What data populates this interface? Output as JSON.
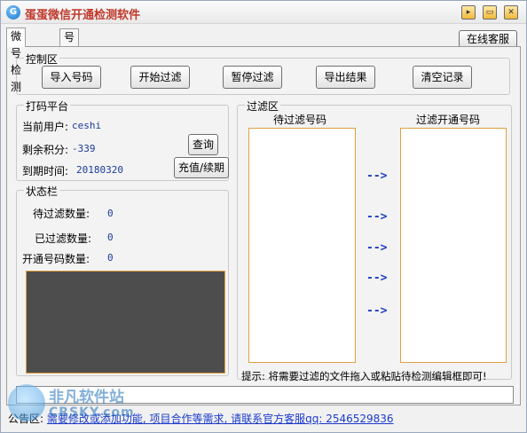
{
  "window": {
    "title": "蛋蛋微信开通检测软件",
    "app_icon_char": "G",
    "controls": [
      {
        "name": "minimize-button",
        "glyph": "▸"
      },
      {
        "name": "maximize-button",
        "glyph": "▭"
      },
      {
        "name": "close-button",
        "glyph": "✕"
      }
    ]
  },
  "tabs": [
    {
      "label": "微号检测",
      "active": true
    },
    {
      "label": "号码生成",
      "active": false
    }
  ],
  "online_service_label": "在线客服",
  "control_area": {
    "title": "控制区",
    "buttons": [
      "导入号码",
      "开始过滤",
      "暂停过滤",
      "导出结果",
      "清空记录"
    ]
  },
  "captcha_platform": {
    "title": "打码平台",
    "user_label": "当前用户:",
    "user_value": "ceshi",
    "points_label": "剩余积分:",
    "points_value": "-339",
    "expire_label": "到期时间:",
    "expire_value": "20180320",
    "query_button": "查询",
    "recharge_button": "充值/续期"
  },
  "status_bar": {
    "title": "状态栏",
    "pending_label": "待过滤数量:",
    "pending_value": "0",
    "filtered_label": "已过滤数量:",
    "filtered_value": "0",
    "open_label": "开通号码数量:",
    "open_value": "0"
  },
  "filter_area": {
    "title": "过滤区",
    "pending_header": "待过滤号码",
    "opened_header": "过滤开通号码",
    "arrows": [
      "-->",
      "-->",
      "-->",
      "-->",
      "-->"
    ],
    "hint": "提示: 将需要过滤的文件拖入或粘贴待检测编辑框即可!"
  },
  "notice": {
    "prefix": "公告区: ",
    "text": "需要修改或添加功能, 项目合作等需求, 请联系官方客服qq: 2546529836"
  },
  "watermark": {
    "line1": "非凡软件站",
    "line2": "CRSKY.com"
  }
}
